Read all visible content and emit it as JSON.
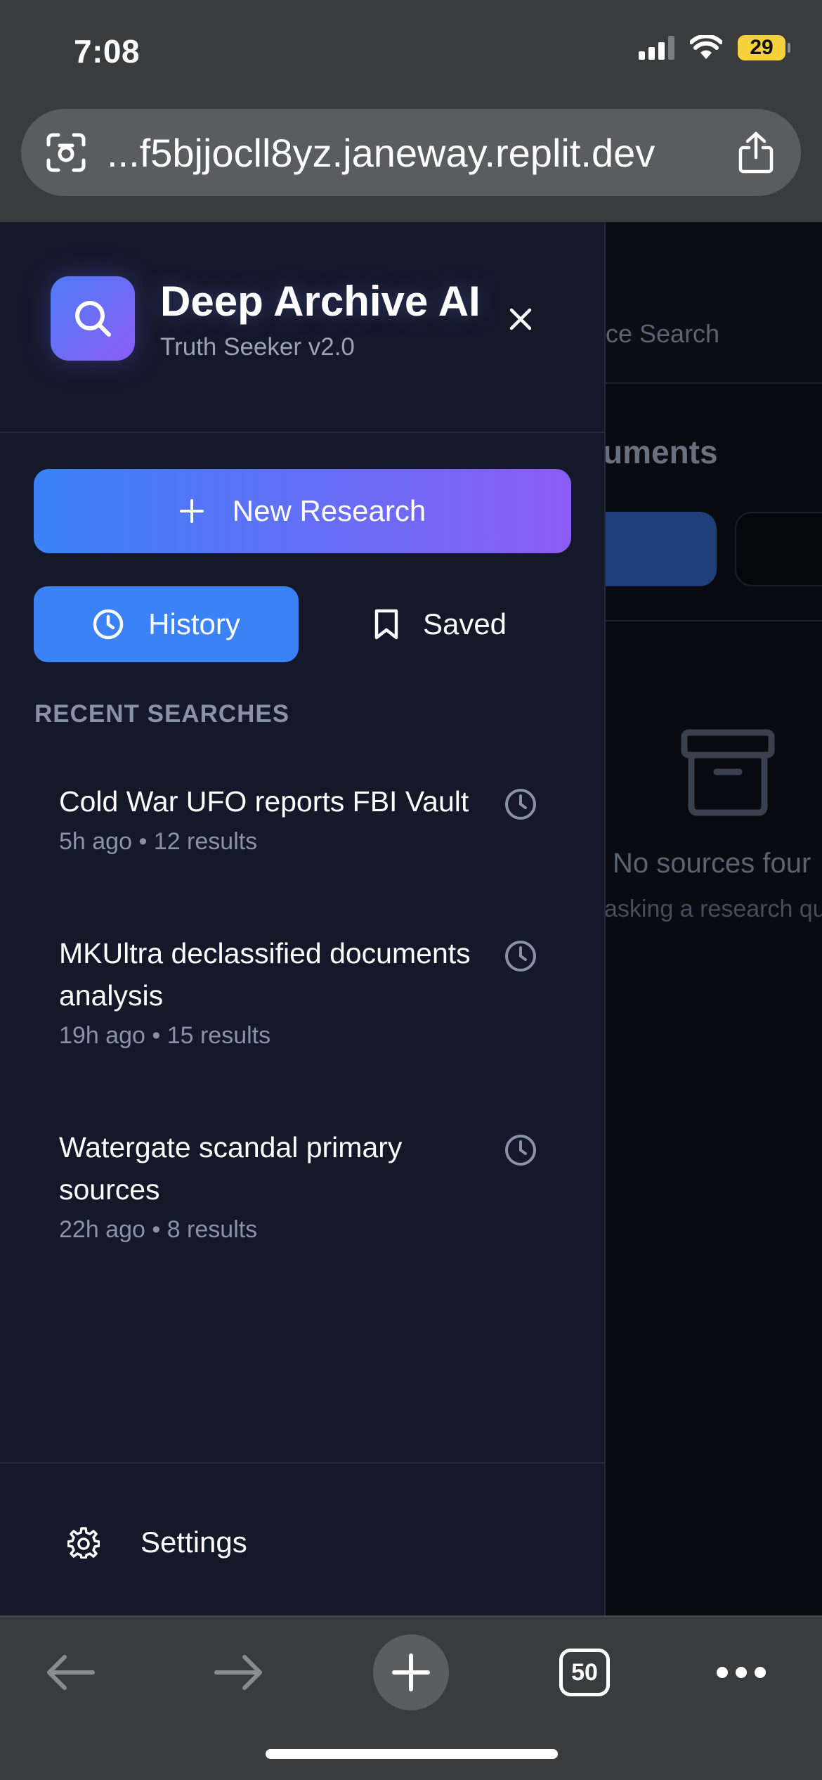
{
  "status_bar": {
    "time": "7:08",
    "battery": "29"
  },
  "browser": {
    "url": "...f5bjjocll8yz.janeway.replit.dev",
    "tab_count": "50"
  },
  "background_app": {
    "search_hint": "rce Search",
    "documents_heading": "uments",
    "empty_title": "No sources four",
    "empty_subtitle": "asking a research qu"
  },
  "drawer": {
    "app_title": "Deep Archive AI",
    "app_subtitle": "Truth Seeker v2.0",
    "new_research_label": "New Research",
    "tabs": {
      "history": "History",
      "saved": "Saved"
    },
    "section_label": "RECENT SEARCHES",
    "recent": [
      {
        "title": "Cold War UFO reports FBI Vault",
        "meta": "5h ago • 12 results"
      },
      {
        "title": "MKUltra declassified documents analysis",
        "meta": "19h ago • 15 results"
      },
      {
        "title": "Watergate scandal primary sources",
        "meta": "22h ago • 8 results"
      }
    ],
    "settings_label": "Settings"
  },
  "colors": {
    "accent_blue": "#3b82f6",
    "accent_purple": "#8b5cf6",
    "drawer_bg": "#141829"
  }
}
